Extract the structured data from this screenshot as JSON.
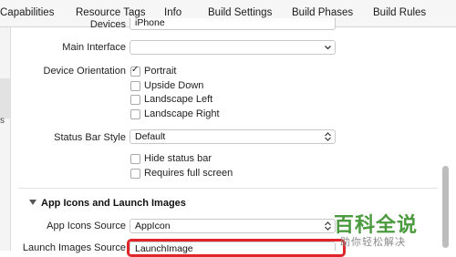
{
  "tabs": [
    "Capabilities",
    "Resource Tags",
    "Info",
    "Build Settings",
    "Build Phases",
    "Build Rules"
  ],
  "sidebar": {
    "fragment": "s"
  },
  "deployment": {
    "devices_label": "Devices",
    "devices_value": "iPhone",
    "main_interface_label": "Main Interface",
    "main_interface_value": "",
    "device_orientation_label": "Device Orientation",
    "orientations": [
      {
        "label": "Portrait",
        "checked": true
      },
      {
        "label": "Upside Down",
        "checked": false
      },
      {
        "label": "Landscape Left",
        "checked": false
      },
      {
        "label": "Landscape Right",
        "checked": false
      }
    ],
    "status_bar_style_label": "Status Bar Style",
    "status_bar_style_value": "Default",
    "hide_status_bar_label": "Hide status bar",
    "requires_full_screen_label": "Requires full screen"
  },
  "app_icons": {
    "section_title": "App Icons and Launch Images",
    "app_icons_source_label": "App Icons Source",
    "app_icons_source_value": "AppIcon",
    "launch_images_source_label": "Launch Images Source",
    "launch_images_source_value": "LaunchImage"
  },
  "watermark": {
    "title": "百科全说",
    "subtitle": "助你轻松解决"
  },
  "colors": {
    "highlight": "#e0252a",
    "watermark": "#4c9a3f"
  }
}
